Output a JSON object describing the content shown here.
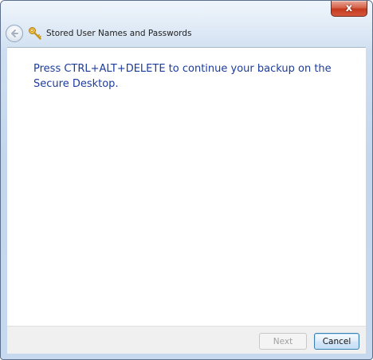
{
  "window": {
    "close_glyph": "x"
  },
  "nav": {
    "back_icon": "back-arrow-icon",
    "key_icon": "key-icon",
    "title": "Stored User Names and Passwords"
  },
  "content": {
    "message": "Press CTRL+ALT+DELETE to continue your backup on the Secure Desktop."
  },
  "footer": {
    "next_label": "Next",
    "cancel_label": "Cancel"
  },
  "colors": {
    "message_text": "#1c3c9c",
    "close_button": "#c43a1e",
    "chrome": "#c7d9ee"
  }
}
